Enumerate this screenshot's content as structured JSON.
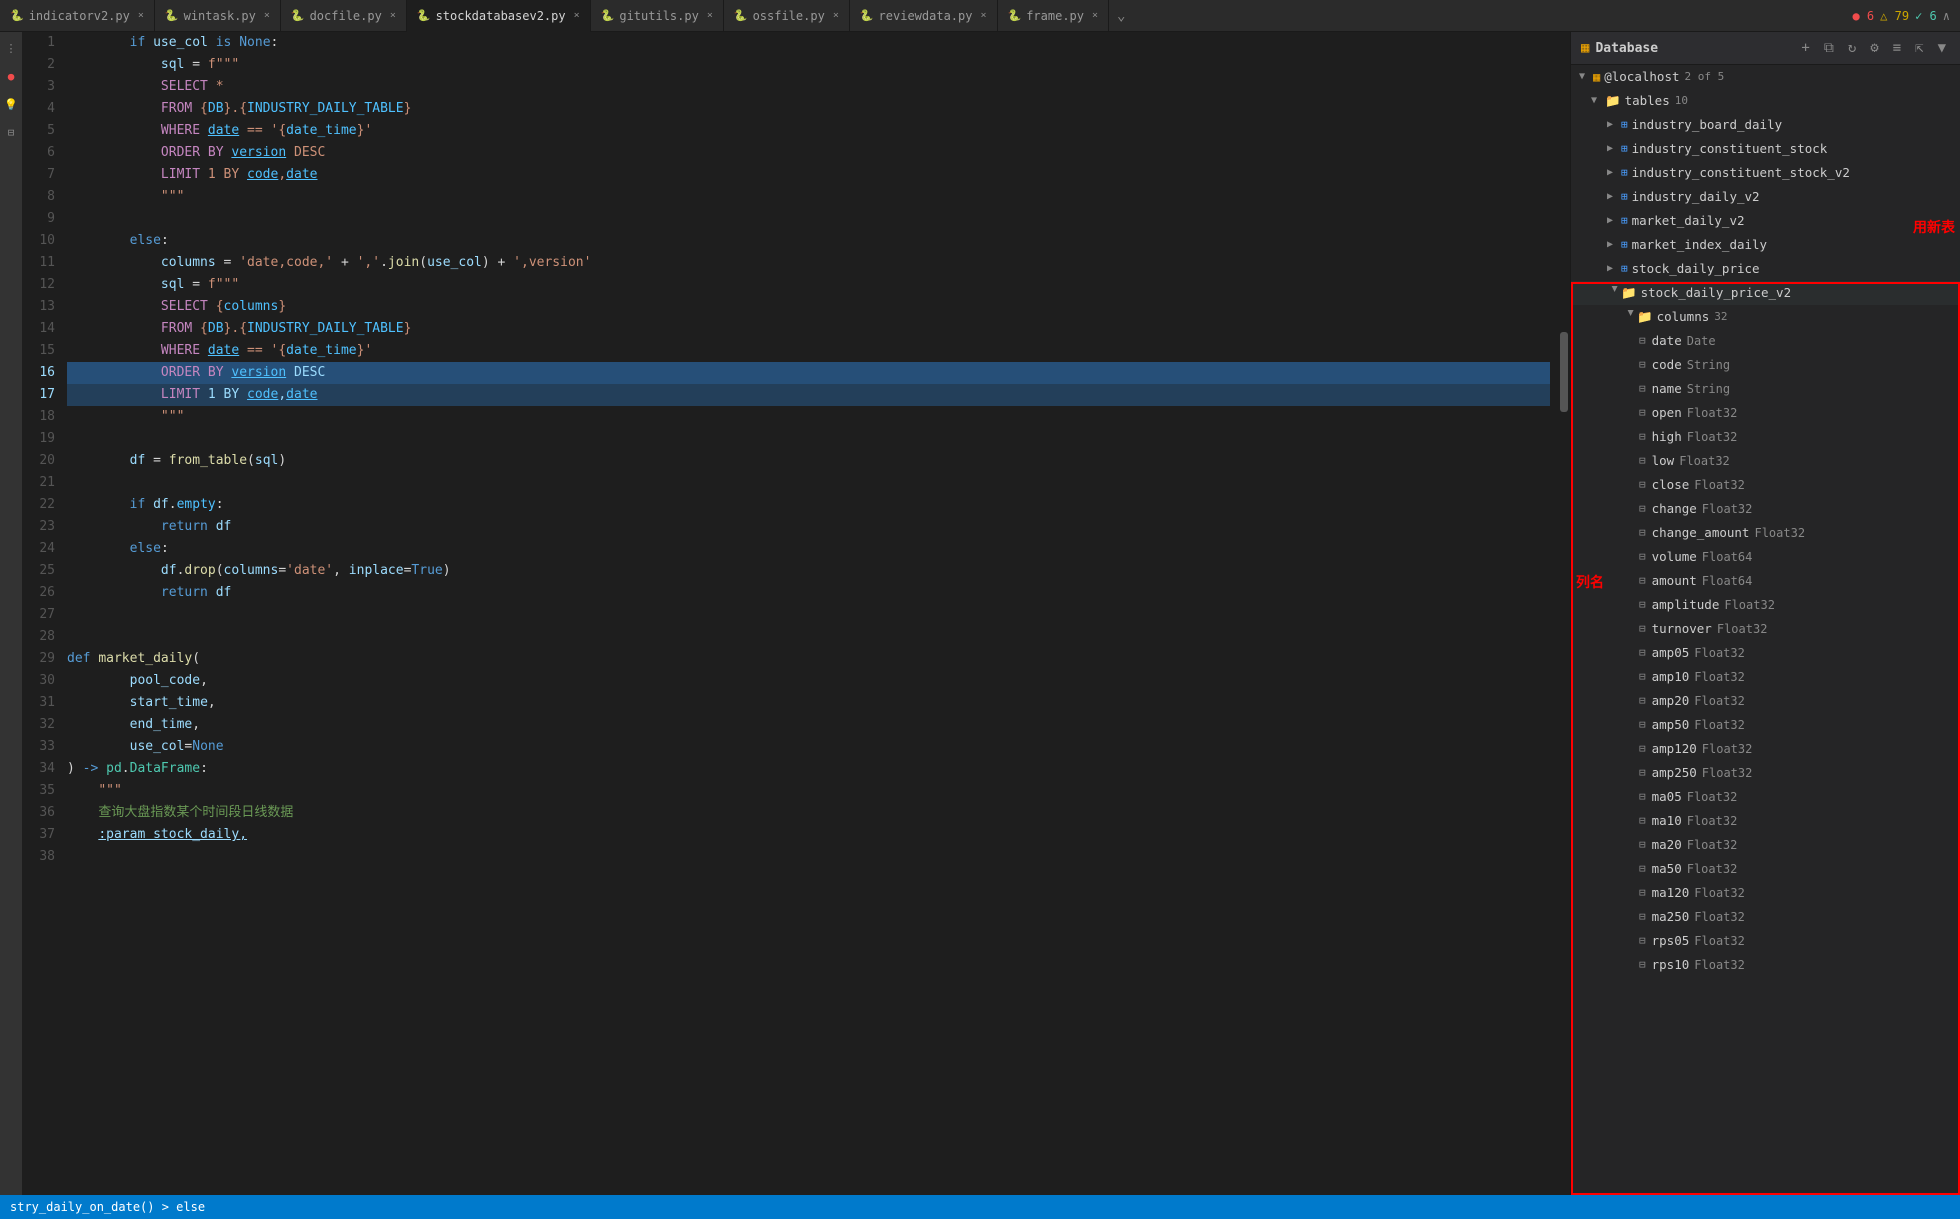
{
  "tabbar": {
    "tabs": [
      {
        "label": "indicatorv2.py",
        "active": false
      },
      {
        "label": "wintask.py",
        "active": false
      },
      {
        "label": "docfile.py",
        "active": false
      },
      {
        "label": "stockdatabasev2.py",
        "active": true
      },
      {
        "label": "gitutils.py",
        "active": false
      },
      {
        "label": "ossfile.py",
        "active": false
      },
      {
        "label": "reviewdata.py",
        "active": false
      },
      {
        "label": "frame.py",
        "active": false
      }
    ],
    "errors": "● 6",
    "warnings": "△ 79",
    "ok": "✓ 6"
  },
  "panel": {
    "title": "Database",
    "server": "@localhost",
    "serverInfo": "2 of 5"
  },
  "tree": {
    "tables_count": "10",
    "tables": [
      {
        "name": "industry_board_daily"
      },
      {
        "name": "industry_constituent_stock"
      },
      {
        "name": "industry_constituent_stock_v2"
      },
      {
        "name": "industry_daily_v2"
      },
      {
        "name": "market_daily_v2"
      },
      {
        "name": "market_index_daily"
      },
      {
        "name": "stock_daily_price"
      },
      {
        "name": "stock_daily_price_v2",
        "expanded": true,
        "columns_count": "32",
        "columns": [
          {
            "name": "date",
            "type": "Date"
          },
          {
            "name": "code",
            "type": "String"
          },
          {
            "name": "name",
            "type": "String"
          },
          {
            "name": "open",
            "type": "Float32"
          },
          {
            "name": "high",
            "type": "Float32"
          },
          {
            "name": "low",
            "type": "Float32"
          },
          {
            "name": "close",
            "type": "Float32"
          },
          {
            "name": "change",
            "type": "Float32"
          },
          {
            "name": "change_amount",
            "type": "Float32"
          },
          {
            "name": "volume",
            "type": "Float64"
          },
          {
            "name": "amount",
            "type": "Float64"
          },
          {
            "name": "amplitude",
            "type": "Float32"
          },
          {
            "name": "turnover",
            "type": "Float32"
          },
          {
            "name": "amp05",
            "type": "Float32"
          },
          {
            "name": "amp10",
            "type": "Float32"
          },
          {
            "name": "amp20",
            "type": "Float32"
          },
          {
            "name": "amp50",
            "type": "Float32"
          },
          {
            "name": "amp120",
            "type": "Float32"
          },
          {
            "name": "amp250",
            "type": "Float32"
          },
          {
            "name": "ma05",
            "type": "Float32"
          },
          {
            "name": "ma10",
            "type": "Float32"
          },
          {
            "name": "ma20",
            "type": "Float32"
          },
          {
            "name": "ma50",
            "type": "Float32"
          },
          {
            "name": "ma120",
            "type": "Float32"
          },
          {
            "name": "ma250",
            "type": "Float32"
          },
          {
            "name": "rps05",
            "type": "Float32"
          },
          {
            "name": "rps10",
            "type": "Float32"
          }
        ]
      }
    ]
  },
  "annotations": {
    "newTable": "用新表",
    "columns": "列名"
  },
  "statusBar": {
    "breadcrumb": "stry_daily_on_date()  >  else"
  },
  "code": {
    "lines": [
      {
        "num": "",
        "text": "        if use_col is None:"
      },
      {
        "num": "",
        "text": "            sql = f\"\"\""
      },
      {
        "num": "",
        "text": "            SELECT *"
      },
      {
        "num": "",
        "text": "            FROM {DB}.{INDUSTRY_DAILY_TABLE}"
      },
      {
        "num": "",
        "text": "            WHERE date == '{date_time}'"
      },
      {
        "num": "",
        "text": "            ORDER BY version DESC"
      },
      {
        "num": "",
        "text": "            LIMIT 1 BY code,date"
      },
      {
        "num": "",
        "text": "            \"\"\""
      },
      {
        "num": "",
        "text": ""
      },
      {
        "num": "",
        "text": "        else:"
      },
      {
        "num": "",
        "text": "            columns = 'date,code,' + ','.join(use_col) + ',version'"
      },
      {
        "num": "",
        "text": "            sql = f\"\"\""
      },
      {
        "num": "",
        "text": "            SELECT {columns}"
      },
      {
        "num": "",
        "text": "            FROM {DB}.{INDUSTRY_DAILY_TABLE}"
      },
      {
        "num": "",
        "text": "            WHERE date == '{date_time}'"
      },
      {
        "num": "",
        "text": "            ORDER BY version DESC",
        "highlight": true
      },
      {
        "num": "",
        "text": "            LIMIT 1 BY code,date",
        "highlight2": true
      },
      {
        "num": "",
        "text": "            \"\"\""
      },
      {
        "num": "",
        "text": ""
      },
      {
        "num": "",
        "text": "        df = from_table(sql)"
      },
      {
        "num": "",
        "text": ""
      },
      {
        "num": "",
        "text": "        if df.empty:"
      },
      {
        "num": "",
        "text": "            return df"
      },
      {
        "num": "",
        "text": "        else:"
      },
      {
        "num": "",
        "text": "            df.drop(columns='date', inplace=True)"
      },
      {
        "num": "",
        "text": "            return df"
      },
      {
        "num": "",
        "text": ""
      },
      {
        "num": "",
        "text": ""
      },
      {
        "num": "",
        "text": "def market_daily("
      },
      {
        "num": "",
        "text": "        pool_code,"
      },
      {
        "num": "",
        "text": "        start_time,"
      },
      {
        "num": "",
        "text": "        end_time,"
      },
      {
        "num": "",
        "text": "        use_col=None"
      },
      {
        "num": "",
        "text": ") -> pd.DataFrame:"
      },
      {
        "num": "",
        "text": "    \"\"\""
      },
      {
        "num": "",
        "text": "    查询大盘指数某个时间段日线数据"
      },
      {
        "num": "",
        "text": "    :param stock_daily,"
      },
      {
        "num": "",
        "text": ""
      }
    ]
  }
}
